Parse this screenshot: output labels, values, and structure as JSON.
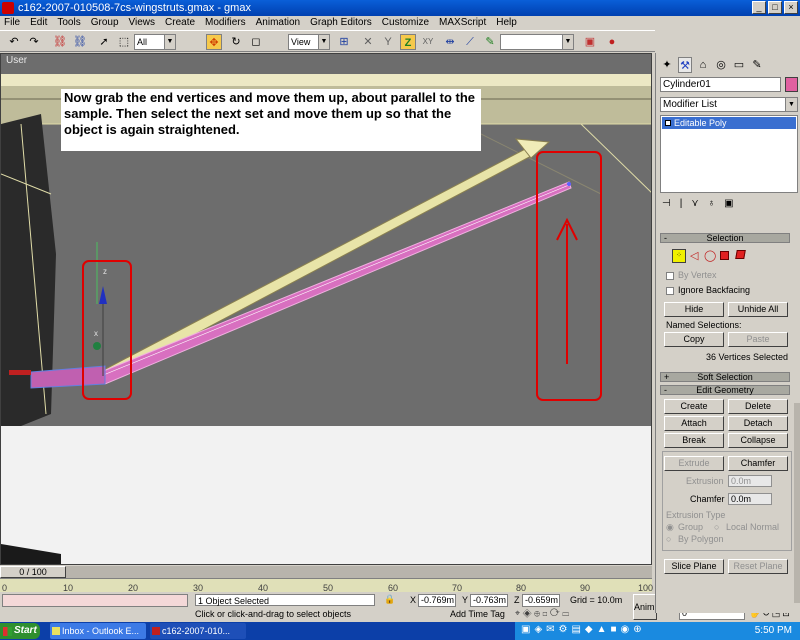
{
  "window": {
    "title": "c162-2007-010508-7cs-wingstruts.gmax - gmax",
    "buttons": {
      "minimize": "_",
      "maximize": "□",
      "close": "×"
    }
  },
  "menu": [
    "File",
    "Edit",
    "Tools",
    "Group",
    "Views",
    "Create",
    "Modifiers",
    "Animation",
    "Graph Editors",
    "Customize",
    "MAXScript",
    "Help"
  ],
  "toolbar": {
    "filter_value": "All",
    "refcoord_value": "View"
  },
  "viewport": {
    "label": "User",
    "instruction": "Now grab the end vertices and move them up, about parallel to the sample.  Then select the next set and move them up so that the object is again straightened.",
    "gizmo_axes": {
      "z": "z",
      "x": "x"
    }
  },
  "command_panel": {
    "object_name": "Cylinder01",
    "object_color": "#e060a0",
    "modifier_list": "Modifier List",
    "stack_item": "Editable Poly",
    "selection": {
      "header": "Selection",
      "by_vertex": "By Vertex",
      "ignore_backfacing": "Ignore Backfacing",
      "hide": "Hide",
      "unhide_all": "Unhide All",
      "named_selections": "Named Selections:",
      "copy": "Copy",
      "paste": "Paste",
      "selected_count": "36 Vertices Selected"
    },
    "soft_selection": {
      "header": "Soft Selection",
      "sign": "+"
    },
    "edit_geometry": {
      "header": "Edit Geometry",
      "sign": "-",
      "create": "Create",
      "delete": "Delete",
      "attach": "Attach",
      "detach": "Detach",
      "break": "Break",
      "collapse": "Collapse",
      "extrude": "Extrude",
      "chamfer": "Chamfer",
      "extrusion_label": "Extrusion",
      "extrusion_value": "0.0m",
      "chamfer_label": "Chamfer",
      "chamfer_value": "0.0m",
      "extrusion_type": "Extrusion Type",
      "group": "Group",
      "local_normal": "Local Normal",
      "by_polygon": "By Polygon",
      "slice_plane": "Slice Plane",
      "reset_plane": "Reset Plane"
    }
  },
  "timeline": {
    "slider_label": "0 / 100",
    "ticks": [
      "0",
      "10",
      "20",
      "30",
      "40",
      "50",
      "60",
      "70",
      "80",
      "90",
      "100"
    ]
  },
  "status": {
    "selection_info": "1 Object Selected",
    "prompt": "Click or click-and-drag to select objects",
    "x_label": "X",
    "x_value": "-0.769m",
    "y_label": "Y",
    "y_value": "-0.763m",
    "z_label": "Z",
    "z_value": "-0.659m",
    "grid": "Grid = 10.0m",
    "add_time_tag": "Add Time Tag",
    "anim": "Anim.",
    "frame": "0"
  },
  "taskbar": {
    "start": "Start",
    "items": [
      "Inbox - Outlook E...",
      "c162-2007-010..."
    ],
    "clock": "5:50 PM"
  }
}
